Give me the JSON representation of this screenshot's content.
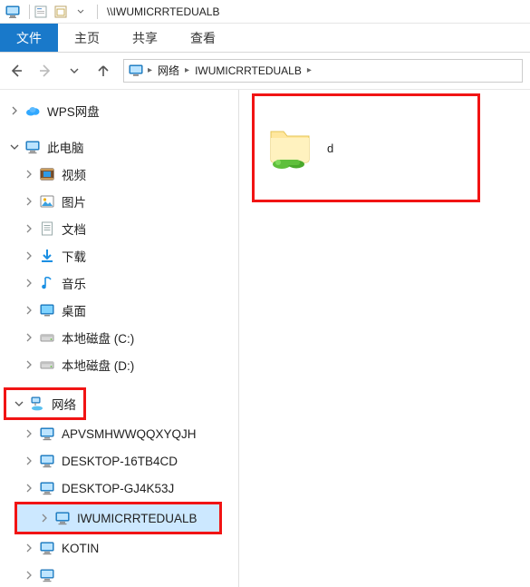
{
  "title": "\\\\IWUMICRRTEDUALB",
  "ribbon": {
    "file": "文件",
    "tabs": [
      "主页",
      "共享",
      "查看"
    ]
  },
  "breadcrumb": {
    "segments": [
      "网络",
      "IWUMICRRTEDUALB"
    ]
  },
  "tree": {
    "wps": "WPS网盘",
    "this_pc": "此电脑",
    "this_pc_children": [
      {
        "label": "视频",
        "icon": "video"
      },
      {
        "label": "图片",
        "icon": "pictures"
      },
      {
        "label": "文档",
        "icon": "documents"
      },
      {
        "label": "下载",
        "icon": "downloads"
      },
      {
        "label": "音乐",
        "icon": "music"
      },
      {
        "label": "桌面",
        "icon": "desktop"
      },
      {
        "label": "本地磁盘 (C:)",
        "icon": "drive"
      },
      {
        "label": "本地磁盘 (D:)",
        "icon": "drive"
      }
    ],
    "network": "网络",
    "network_children": [
      "APVSMHWWQQXYQJH",
      "DESKTOP-16TB4CD",
      "DESKTOP-GJ4K53J",
      "IWUMICRRTEDUALB",
      "KOTIN"
    ]
  },
  "content": {
    "items": [
      {
        "label": "d"
      }
    ]
  },
  "highlights": {
    "network_row": true,
    "network_selected_index": 3,
    "content_area": true
  }
}
